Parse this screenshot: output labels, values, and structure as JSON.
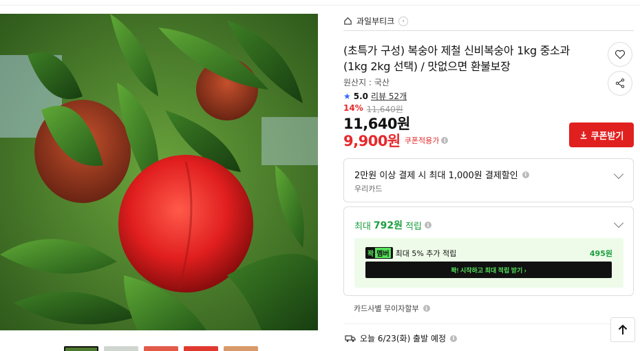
{
  "store": {
    "name": "과일부티크",
    "chevron": "›"
  },
  "product": {
    "title": "(초특가 구성) 복숭아 제철 신비복숭아 1kg 중소과 (1kg 2kg 선택) / 맛없으면 환불보장",
    "origin": "원산지 : 국산",
    "rating": "5.0",
    "review": "리뷰 52개",
    "discount_pct": "14%",
    "original_price": "11,640원",
    "price": "11,640원",
    "coupon_price": "9,900원",
    "coupon_label": "쿠폰적용가"
  },
  "buttons": {
    "coupon": "쿠폰받기",
    "member_cta": "꽉! 시작하고 최대 적립 받기 ›"
  },
  "benefits": {
    "payment_discount": "2만원 이상 결제 시 최대 1,000원 결제할인",
    "card_name": "우리카드",
    "points_prefix": "최대",
    "points_amount": "792원",
    "points_suffix": "적립",
    "member_badge_main": "꽉",
    "member_badge_tail": "멤버",
    "member_text": "최대 5% 추가 적립",
    "member_amount": "495원",
    "installment": "카드사별 무이자할부"
  },
  "shipping": {
    "text": "오늘 6/23(화) 출발 예정"
  },
  "icons": {
    "home": "home-icon",
    "heart": "heart-icon",
    "share": "share-icon",
    "star": "star-icon",
    "info": "info-icon",
    "download": "download-icon",
    "truck": "truck-icon",
    "arrow_up": "arrow-up-icon"
  },
  "colors": {
    "accent_red": "#e0201f",
    "price_red": "#e8282b",
    "green": "#1a9e3e",
    "member_green": "#55e25b",
    "star_blue": "#3366ff"
  }
}
